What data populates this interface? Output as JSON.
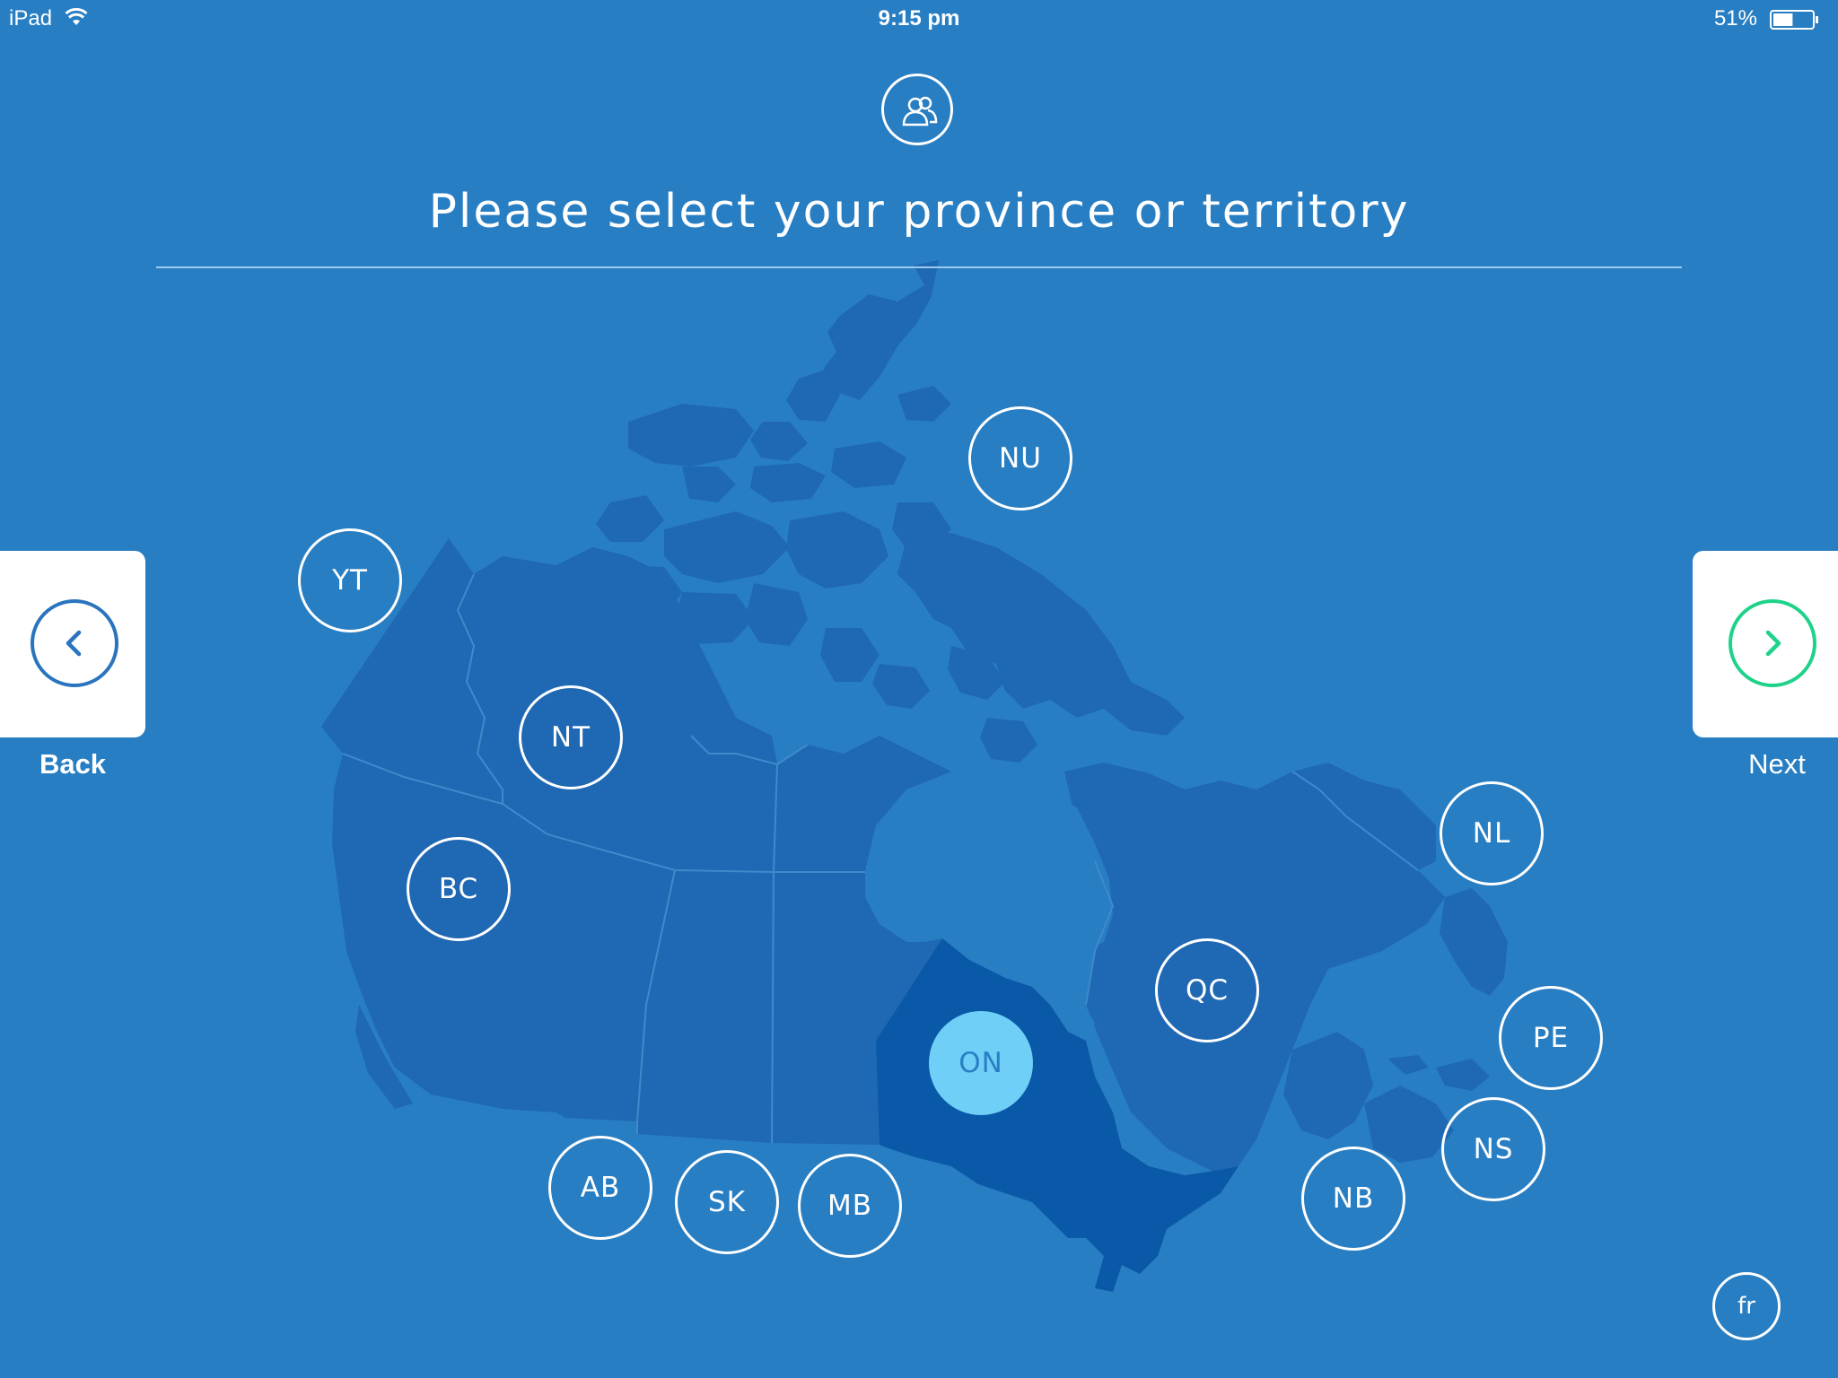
{
  "status_bar": {
    "device": "iPad",
    "time": "9:15 pm",
    "battery": "51%",
    "battery_level": 0.51
  },
  "header": {
    "icon": "people-icon",
    "title": "Please select your province or territory"
  },
  "provinces": [
    {
      "code": "NU",
      "selected": false
    },
    {
      "code": "YT",
      "selected": false
    },
    {
      "code": "NT",
      "selected": false
    },
    {
      "code": "BC",
      "selected": false
    },
    {
      "code": "AB",
      "selected": false
    },
    {
      "code": "SK",
      "selected": false
    },
    {
      "code": "MB",
      "selected": false
    },
    {
      "code": "ON",
      "selected": true
    },
    {
      "code": "QC",
      "selected": false
    },
    {
      "code": "NL",
      "selected": false
    },
    {
      "code": "PE",
      "selected": false
    },
    {
      "code": "NS",
      "selected": false
    },
    {
      "code": "NB",
      "selected": false
    }
  ],
  "navigation": {
    "back_label": "Back",
    "back_icon": "chevron-left-icon",
    "next_label": "Next",
    "next_icon": "chevron-right-icon"
  },
  "language_toggle": "fr",
  "colors": {
    "background": "#287ec3",
    "land": "#1f68b3",
    "selected_region": "#0a58a8",
    "selected_button": "#6fcff7",
    "next_accent": "#1fd28a",
    "back_accent": "#2a74bd"
  }
}
